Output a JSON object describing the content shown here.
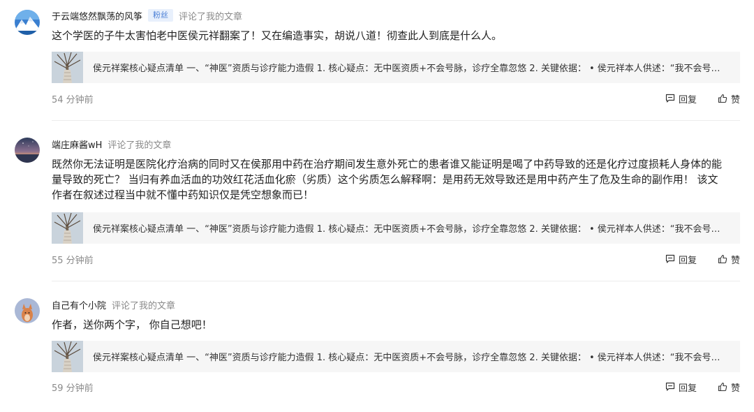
{
  "comments": [
    {
      "username": "于云端悠然飘荡的风筝",
      "badge": "粉丝",
      "action": "评论了我的文章",
      "text": "这个学医的子牛太害怕老中医侯元祥翻案了！又在编造事实，胡说八道！彻查此人到底是什么人。",
      "article": "侯元祥案核心疑点清单 一、“神医”资质与诊疗能力造假 1. 核心疑点：无中医资质+不会号脉，诊疗全靠忽悠 2. 关键依据：  • 侯元祥本人供述：“我不会号…",
      "time": "54 分钟前",
      "reply_label": "回复",
      "like_label": "赞",
      "avatar_icon": "mountain-avatar"
    },
    {
      "username": "端庄麻酱wH",
      "badge": "",
      "action": "评论了我的文章",
      "text_lines": [
        "既然你无法证明是医院化疗治病的同时又在侯那用中药在治疗期间发生意外死亡的患者谁又能证明是喝了中药导致的还是化疗过度损耗人身体的能",
        "量导致的死亡？ 当归有养血活血的功效红花活血化瘀（劣质）这个劣质怎么解释啊：是用药无效导致还是用中药产生了危及生命的副作用！ 该文",
        "作者在叙述过程当中就不懂中药知识仅是凭空想象而已！"
      ],
      "article": "侯元祥案核心疑点清单 一、“神医”资质与诊疗能力造假 1. 核心疑点：无中医资质+不会号脉，诊疗全靠忽悠 2. 关键依据：  • 侯元祥本人供述：“我不会号…",
      "time": "55 分钟前",
      "reply_label": "回复",
      "like_label": "赞",
      "avatar_icon": "sunset-avatar"
    },
    {
      "username": "自己有个小院",
      "badge": "",
      "action": "评论了我的文章",
      "text": "作者，送你两个字， 你自己想吧！",
      "article": "侯元祥案核心疑点清单 一、“神医”资质与诊疗能力造假 1. 核心疑点：无中医资质+不会号脉，诊疗全靠忽悠 2. 关键依据：  • 侯元祥本人供述：“我不会号…",
      "time": "59 分钟前",
      "reply_label": "回复",
      "like_label": "赞",
      "avatar_icon": "fox-avatar"
    }
  ],
  "colors": {
    "badge_bg": "#e8f0fc",
    "badge_text": "#4a7fd6",
    "card_bg": "#f6f6f6",
    "muted_text": "#8a8a8a"
  }
}
